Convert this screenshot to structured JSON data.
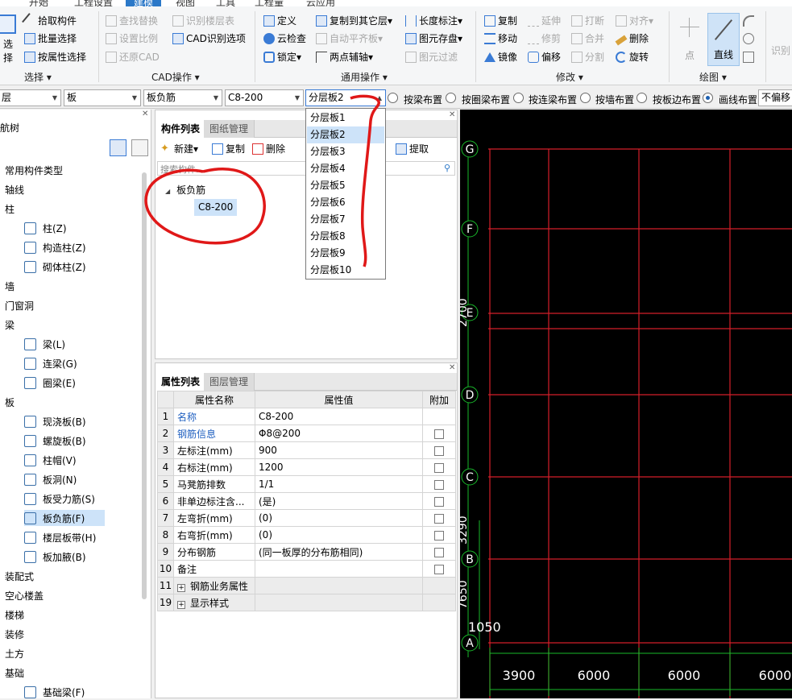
{
  "menu": {
    "items": [
      "开始",
      "工程设置",
      "建模",
      "视图",
      "工具",
      "工程量",
      "云应用"
    ],
    "active": "建模"
  },
  "ribbon": {
    "select_group": {
      "label": "选择",
      "buttons": [
        "拾取构件",
        "批量选择",
        "按属性选择"
      ],
      "big_button": "选择"
    },
    "cad_group": {
      "label": "CAD操作",
      "buttons": [
        "查找替换",
        "设置比例",
        "还原CAD",
        "识别楼层表",
        "CAD识别选项"
      ]
    },
    "common_group": {
      "label": "通用操作",
      "buttons": [
        "定义",
        "云检查",
        "锁定",
        "复制到其它层",
        "自动平齐板",
        "两点辅轴",
        "长度标注",
        "图元存盘",
        "图元过滤"
      ]
    },
    "modify_group": {
      "label": "修改",
      "buttons": [
        "复制",
        "移动",
        "镜像",
        "延伸",
        "修剪",
        "偏移",
        "打断",
        "合并",
        "分割",
        "对齐",
        "删除",
        "旋转"
      ]
    },
    "draw_group": {
      "label": "绘图",
      "buttons": [
        "点",
        "直线"
      ],
      "selected": "直线"
    },
    "recognize_label": "识别"
  },
  "toolbar": {
    "combo_floor": "层",
    "combo_category": "板",
    "combo_type": "板负筋",
    "combo_component": "C8-200",
    "combo_layer": "分层板2",
    "radios": [
      "按梁布置",
      "按圈梁布置",
      "按连梁布置",
      "按墙布置",
      "按板边布置",
      "画线布置"
    ],
    "radio_selected": "画线布置",
    "offset_combo": "不偏移"
  },
  "nav": {
    "title": "导航树",
    "items": [
      {
        "label": "常用构件类型",
        "type": "cat"
      },
      {
        "label": "轴线",
        "type": "cat"
      },
      {
        "label": "柱",
        "type": "cat"
      },
      {
        "label": "柱(Z)",
        "type": "sub",
        "icon": "column-icon"
      },
      {
        "label": "构造柱(Z)",
        "type": "sub",
        "icon": "constructional-column-icon"
      },
      {
        "label": "砌体柱(Z)",
        "type": "sub",
        "icon": "masonry-column-icon"
      },
      {
        "label": "墙",
        "type": "cat"
      },
      {
        "label": "门窗洞",
        "type": "cat"
      },
      {
        "label": "梁",
        "type": "cat"
      },
      {
        "label": "梁(L)",
        "type": "sub",
        "icon": "beam-icon"
      },
      {
        "label": "连梁(G)",
        "type": "sub",
        "icon": "coupling-beam-icon"
      },
      {
        "label": "圈梁(E)",
        "type": "sub",
        "icon": "ring-beam-icon"
      },
      {
        "label": "板",
        "type": "cat"
      },
      {
        "label": "现浇板(B)",
        "type": "sub",
        "icon": "cast-slab-icon"
      },
      {
        "label": "螺旋板(B)",
        "type": "sub",
        "icon": "spiral-slab-icon"
      },
      {
        "label": "柱帽(V)",
        "type": "sub",
        "icon": "column-cap-icon"
      },
      {
        "label": "板洞(N)",
        "type": "sub",
        "icon": "slab-hole-icon"
      },
      {
        "label": "板受力筋(S)",
        "type": "sub",
        "icon": "slab-rebar-icon"
      },
      {
        "label": "板负筋(F)",
        "type": "sub",
        "icon": "slab-negative-rebar-icon",
        "selected": true
      },
      {
        "label": "楼层板带(H)",
        "type": "sub",
        "icon": "slab-strip-icon"
      },
      {
        "label": "板加腋(B)",
        "type": "sub",
        "icon": "slab-haunch-icon"
      },
      {
        "label": "装配式",
        "type": "cat"
      },
      {
        "label": "空心楼盖",
        "type": "cat"
      },
      {
        "label": "楼梯",
        "type": "cat"
      },
      {
        "label": "装修",
        "type": "cat"
      },
      {
        "label": "土方",
        "type": "cat"
      },
      {
        "label": "基础",
        "type": "cat"
      },
      {
        "label": "基础梁(F)",
        "type": "sub",
        "icon": "foundation-beam-icon"
      }
    ]
  },
  "component_list": {
    "tabs": [
      "构件列表",
      "图纸管理"
    ],
    "actions": [
      "新建",
      "复制",
      "删除",
      "提取"
    ],
    "search_placeholder": "搜索构件...",
    "tree_parent": "板负筋",
    "tree_child": "C8-200"
  },
  "dropdown": {
    "options": [
      "分层板1",
      "分层板2",
      "分层板3",
      "分层板4",
      "分层板5",
      "分层板6",
      "分层板7",
      "分层板8",
      "分层板9",
      "分层板10"
    ],
    "selected": "分层板2"
  },
  "properties": {
    "tabs": [
      "属性列表",
      "图层管理"
    ],
    "headers": [
      "属性名称",
      "属性值",
      "附加"
    ],
    "rows": [
      {
        "no": "1",
        "name": "名称",
        "value": "C8-200",
        "blue": true,
        "check": false
      },
      {
        "no": "2",
        "name": "钢筋信息",
        "value": "Φ8@200",
        "blue": true,
        "check": true
      },
      {
        "no": "3",
        "name": "左标注(mm)",
        "value": "900",
        "blue": false,
        "check": true
      },
      {
        "no": "4",
        "name": "右标注(mm)",
        "value": "1200",
        "blue": false,
        "check": true
      },
      {
        "no": "5",
        "name": "马凳筋排数",
        "value": "1/1",
        "blue": false,
        "check": true
      },
      {
        "no": "6",
        "name": "非单边标注含...",
        "value": "(是)",
        "blue": false,
        "check": true
      },
      {
        "no": "7",
        "name": "左弯折(mm)",
        "value": "(0)",
        "blue": false,
        "check": true
      },
      {
        "no": "8",
        "name": "右弯折(mm)",
        "value": "(0)",
        "blue": false,
        "check": true
      },
      {
        "no": "9",
        "name": "分布钢筋",
        "value": "(同一板厚的分布筋相同)",
        "blue": false,
        "check": true
      },
      {
        "no": "10",
        "name": "备注",
        "value": "",
        "blue": false,
        "check": true
      },
      {
        "no": "11",
        "name": "钢筋业务属性",
        "value": "",
        "blue": false,
        "check": false,
        "expand": true
      },
      {
        "no": "19",
        "name": "显示样式",
        "value": "",
        "blue": false,
        "check": false,
        "expand": true
      }
    ]
  },
  "canvas": {
    "axis_labels": [
      "G",
      "F",
      "E",
      "D",
      "C",
      "B",
      "A"
    ],
    "dims_bottom": [
      "3900",
      "6000",
      "6000",
      "6000"
    ],
    "dims_left": [
      "2700",
      "7650",
      "3290",
      "1050"
    ],
    "colors": {
      "grid": "#d41f2a",
      "axis": "#18b82a",
      "label": "#ffffff",
      "background": "#000000"
    }
  },
  "colors": {
    "accent": "#2b78c8",
    "selected_bg": "#cde3f9",
    "annotation": "#e01818"
  }
}
